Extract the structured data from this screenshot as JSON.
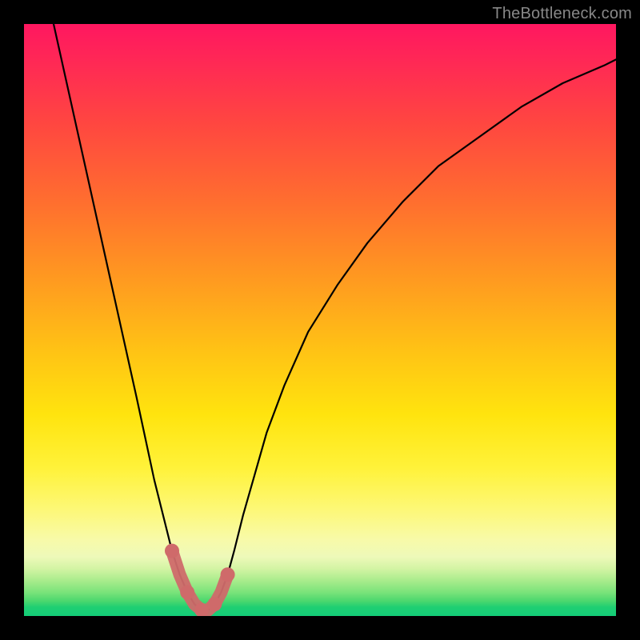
{
  "watermark": "TheBottleneck.com",
  "chart_data": {
    "type": "line",
    "title": "",
    "xlabel": "",
    "ylabel": "",
    "xlim": [
      0,
      100
    ],
    "ylim": [
      0,
      100
    ],
    "series": [
      {
        "name": "curve",
        "x": [
          5,
          7,
          9,
          11,
          13,
          15,
          17,
          19,
          20.5,
          22,
          23.5,
          25,
          26.3,
          27.6,
          28.8,
          30,
          31.1,
          32.2,
          33.3,
          34.4,
          35.5,
          37,
          39,
          41,
          44,
          48,
          53,
          58,
          64,
          70,
          77,
          84,
          91,
          98,
          100
        ],
        "y": [
          100,
          91,
          82,
          73,
          64,
          55,
          46,
          37,
          30,
          23,
          17,
          11,
          7,
          4,
          2,
          1,
          1,
          2,
          4,
          7,
          11,
          17,
          24,
          31,
          39,
          48,
          56,
          63,
          70,
          76,
          81,
          86,
          90,
          93,
          94
        ]
      },
      {
        "name": "highlight-band",
        "x": [
          25,
          26.3,
          27.6,
          28.8,
          30,
          31.1,
          32.2,
          33.3,
          34.4
        ],
        "y": [
          11,
          7,
          4,
          2,
          1,
          1,
          2,
          4,
          7
        ]
      }
    ],
    "colors": {
      "curve": "#000000",
      "highlight": "#cf6a6a"
    }
  }
}
